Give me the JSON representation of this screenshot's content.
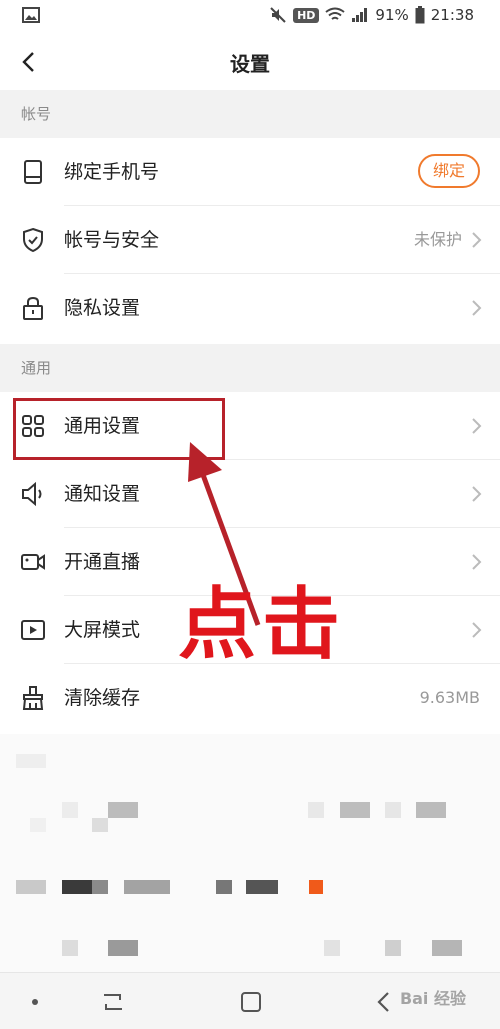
{
  "status_bar": {
    "hd": "HD",
    "battery": "91%",
    "time": "21:38"
  },
  "header": {
    "title": "设置"
  },
  "sections": {
    "account": {
      "header": "帐号",
      "items": [
        {
          "label": "绑定手机号",
          "button": "绑定"
        },
        {
          "label": "帐号与安全",
          "value": "未保护"
        },
        {
          "label": "隐私设置"
        }
      ]
    },
    "general": {
      "header": "通用",
      "items": [
        {
          "label": "通用设置"
        },
        {
          "label": "通知设置"
        },
        {
          "label": "开通直播"
        },
        {
          "label": "大屏模式"
        },
        {
          "label": "清除缓存",
          "value": "9.63MB"
        }
      ]
    }
  },
  "annotation": {
    "text": "点击"
  },
  "watermark": "Bai 经验",
  "colors": {
    "accent": "#f07a2d",
    "highlight_box": "#b7222a",
    "annotation": "#e0161c",
    "section_bg": "#f2f2f2"
  }
}
